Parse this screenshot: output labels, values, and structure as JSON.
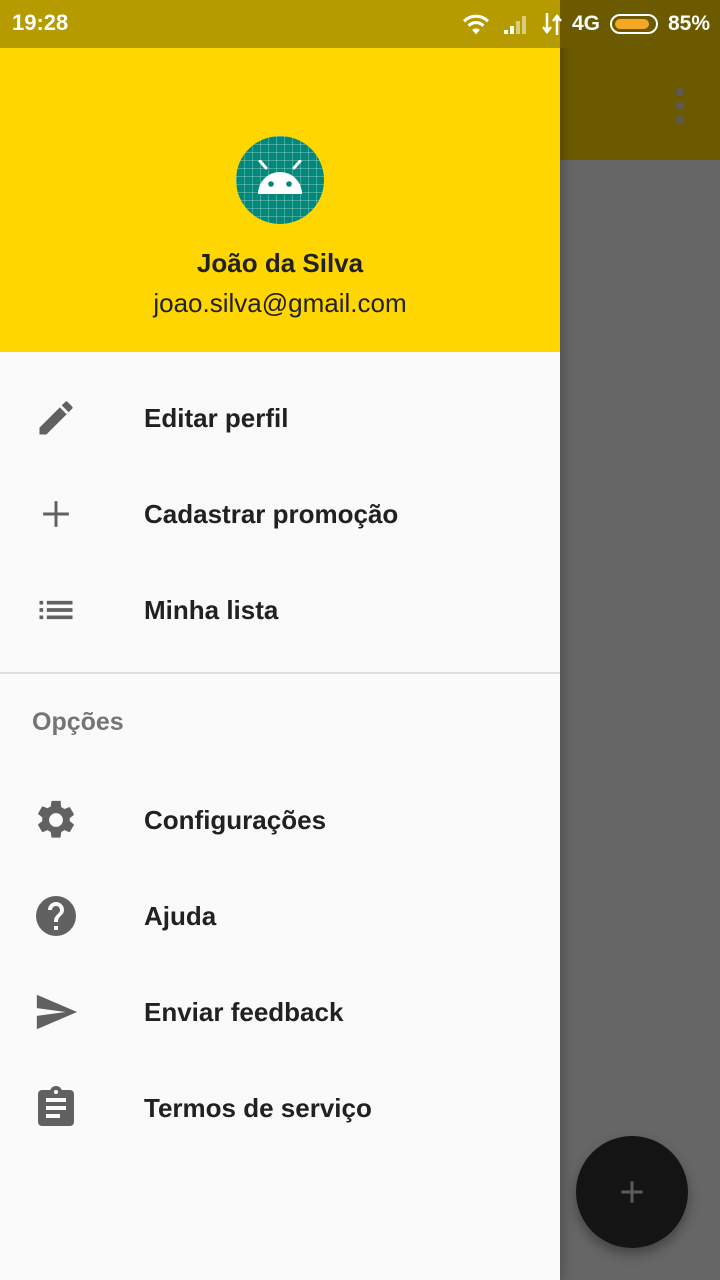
{
  "status_bar": {
    "time": "19:28",
    "network": "4G",
    "battery": "85%",
    "battery_level": 0.85
  },
  "header": {
    "user_name": "João da Silva",
    "user_email": "joao.silva@gmail.com",
    "avatar_icon": "android-icon",
    "background_color": "#ffd600"
  },
  "menu": {
    "items": [
      {
        "label": "Editar perfil",
        "icon": "edit-icon"
      },
      {
        "label": "Cadastrar promoção",
        "icon": "add-icon"
      },
      {
        "label": "Minha lista",
        "icon": "list-icon"
      }
    ],
    "section_title": "Opções",
    "options": [
      {
        "label": "Configurações",
        "icon": "settings-icon"
      },
      {
        "label": "Ajuda",
        "icon": "help-icon"
      },
      {
        "label": "Enviar feedback",
        "icon": "send-icon"
      },
      {
        "label": "Termos de serviço",
        "icon": "clipboard-icon"
      }
    ]
  },
  "fab": {
    "icon": "add-icon"
  },
  "colors": {
    "accent": "#ffd600",
    "icon": "#616161",
    "text": "#212121"
  }
}
